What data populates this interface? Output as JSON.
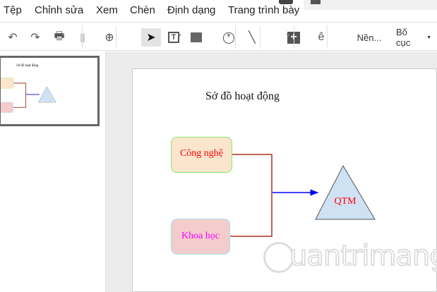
{
  "menu": [
    "Tệp",
    "Chỉnh sửa",
    "Xem",
    "Chèn",
    "Định dạng",
    "Trang trình bày"
  ],
  "toolbar": {
    "background_label": "Nền...",
    "layout_label": "Bố cục",
    "font_glyph": "ê"
  },
  "slide": {
    "title": "Sở đồ hoạt động",
    "box1": "Công nghệ",
    "box2": "Khoa học",
    "triangle": "QTM"
  },
  "colors": {
    "box1_fill": "#fce5cd",
    "box1_border": "#88e86a",
    "box2_fill": "#f4cccc",
    "box2_border": "#9ee8ee",
    "box1_text": "#ff0000",
    "box2_text": "#ff00ff",
    "triangle_fill": "#cfe2f3",
    "connector": "#a8321e",
    "arrow": "#0000ff"
  },
  "watermark": "uantrimang"
}
